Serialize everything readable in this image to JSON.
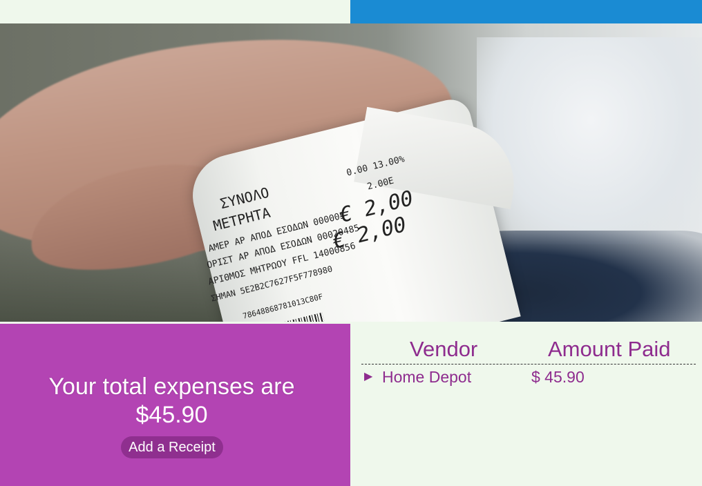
{
  "colors": {
    "top_bar": "#1a8bd3",
    "summary_panel": "#b344b3",
    "button": "#8f2f8f",
    "table_text": "#8e2c8e",
    "page_background": "#eff8ec"
  },
  "hero": {
    "receipt_lines": {
      "top1": "0.00 13.00%",
      "top2": "2.00E",
      "side1": "ΣΥΝΟΛΟ",
      "side2": "ΜΕΤΡΗΤΑ",
      "price1": "€ 2,00",
      "price2": "€ 2,00",
      "line1": "ΑΜΕΡ ΑΡ ΑΠΟΔ ΕΣΟΔΩΝ  000005",
      "line2": "ΟΡΙΣΤ ΑΡ ΑΠΟΔ ΕΣΟΔΩΝ 00020485",
      "line3": "ΑΡΙΘΜΟΣ ΜΗΤΡΩΟΥ  FFL 14000856",
      "line4": "ΣΗΜΑΝ 5E2B2C7627F5F778980",
      "line5": "78648868781013C80F"
    }
  },
  "summary": {
    "label": "Your total expenses are",
    "total": "$45.90",
    "add_button_label": "Add a Receipt"
  },
  "table": {
    "headers": [
      "Vendor",
      "Amount Paid"
    ],
    "rows": [
      {
        "caret": "▶",
        "vendor": "Home Depot",
        "amount": "$ 45.90"
      }
    ]
  }
}
